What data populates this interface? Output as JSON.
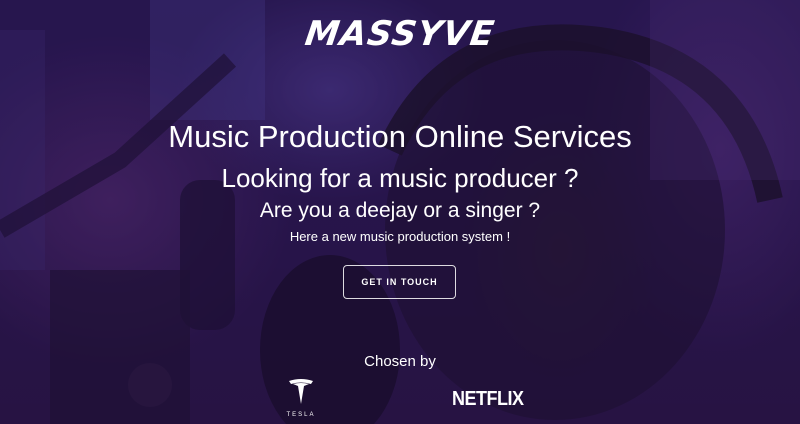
{
  "brand": {
    "logo_text": "MASSYVE"
  },
  "hero": {
    "title": "Music Production Online Services",
    "subtitle": "Looking for a music producer ?",
    "question": "Are you a deejay or a singer ?",
    "tagline": "Here a new music production system !",
    "cta_label": "GET IN TOUCH"
  },
  "clients": {
    "label": "Chosen by",
    "logos": [
      {
        "name": "TESLA",
        "icon": "tesla-logo-icon"
      },
      {
        "name": "NETFLIX",
        "icon": "netflix-logo-icon"
      }
    ]
  },
  "colors": {
    "overlay": "#23124a",
    "text": "#ffffff"
  }
}
